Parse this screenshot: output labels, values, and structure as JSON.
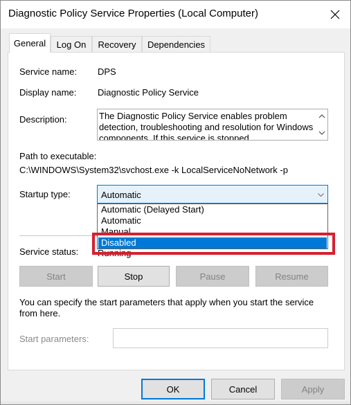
{
  "window": {
    "title": "Diagnostic Policy Service Properties (Local Computer)"
  },
  "tabs": [
    {
      "label": "General",
      "active": true
    },
    {
      "label": "Log On",
      "active": false
    },
    {
      "label": "Recovery",
      "active": false
    },
    {
      "label": "Dependencies",
      "active": false
    }
  ],
  "general": {
    "service_name_label": "Service name:",
    "service_name_value": "DPS",
    "display_name_label": "Display name:",
    "display_name_value": "Diagnostic Policy Service",
    "description_label": "Description:",
    "description_value": "The Diagnostic Policy Service enables problem detection, troubleshooting and resolution for Windows components.  If this service is stopped",
    "path_label": "Path to executable:",
    "path_value": "C:\\WINDOWS\\System32\\svchost.exe -k LocalServiceNoNetwork -p",
    "startup_type_label": "Startup type:",
    "startup_type_value": "Automatic",
    "startup_options": [
      "Automatic (Delayed Start)",
      "Automatic",
      "Manual",
      "Disabled"
    ],
    "startup_highlighted": "Disabled",
    "service_status_label": "Service status:",
    "service_status_value": "Running",
    "info_text_line1": "You can specify the start parameters that apply when you start the service",
    "info_text_line2": "from here.",
    "start_params_label": "Start parameters:",
    "start_params_value": ""
  },
  "service_buttons": {
    "start": "Start",
    "stop": "Stop",
    "pause": "Pause",
    "resume": "Resume"
  },
  "dialog_buttons": {
    "ok": "OK",
    "cancel": "Cancel",
    "apply": "Apply"
  },
  "colors": {
    "accent": "#0078d7",
    "highlight_annotation": "#d6202f"
  },
  "icons": {
    "close": "close-icon",
    "combo_arrow": "chevron-down-icon",
    "scroll_up": "chevron-up-icon",
    "scroll_down": "chevron-down-icon"
  }
}
